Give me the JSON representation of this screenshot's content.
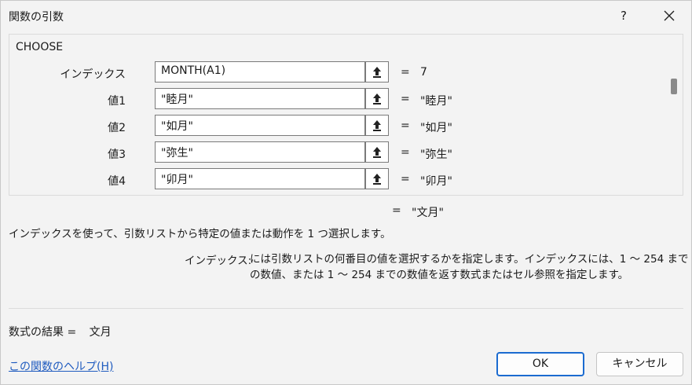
{
  "window": {
    "title": "関数の引数",
    "help_label": "?",
    "close_label": "✕"
  },
  "function_name": "CHOOSE",
  "args": [
    {
      "label": "インデックス",
      "input": "MONTH(A1)",
      "equals": "=",
      "value": "7"
    },
    {
      "label": "値1",
      "input": "\"睦月\"",
      "equals": "=",
      "value": "\"睦月\""
    },
    {
      "label": "値2",
      "input": "\"如月\"",
      "equals": "=",
      "value": "\"如月\""
    },
    {
      "label": "値3",
      "input": "\"弥生\"",
      "equals": "=",
      "value": "\"弥生\""
    },
    {
      "label": "値4",
      "input": "\"卯月\"",
      "equals": "=",
      "value": "\"卯月\""
    }
  ],
  "overall": {
    "equals": "=",
    "value": "\"文月\""
  },
  "description": "インデックスを使って、引数リストから特定の値または動作を 1 つ選択します。",
  "arg_help": {
    "name": "インデックス:",
    "text": "には引数リストの何番目の値を選択するかを指定します。インデックスには、1 ～ 254 までの数値、または 1 ～ 254 までの数値を返す数式またはセル参照を指定します。"
  },
  "result": {
    "label": "数式の結果 =",
    "value": "文月"
  },
  "help_link": "この関数のヘルプ(H)",
  "buttons": {
    "ok": "OK",
    "cancel": "キャンセル"
  },
  "colors": {
    "accent": "#1b6bd0",
    "link": "#1f5bbf"
  },
  "icons": {
    "ref": "collapse-dialog-icon",
    "close": "close-icon"
  }
}
